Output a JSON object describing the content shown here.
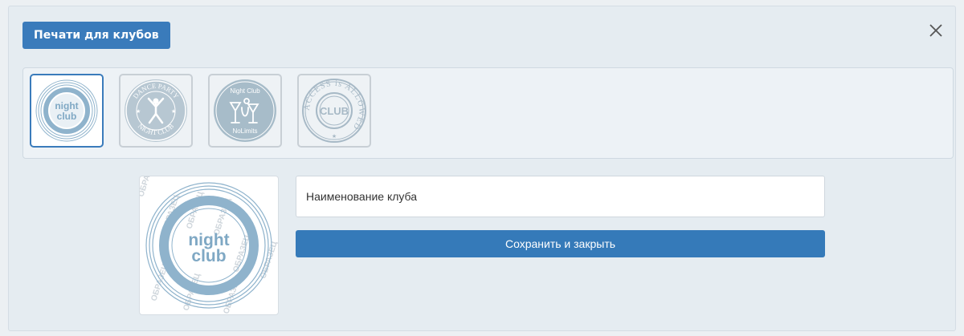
{
  "dialog": {
    "title": "Печати для клубов"
  },
  "stamps": [
    {
      "name": "night-club",
      "lines": [
        "night",
        "club"
      ],
      "selected": true
    },
    {
      "name": "dance-party",
      "top_text": "DANCE PARTY",
      "bottom_text": "NIGHT CLUB",
      "selected": false
    },
    {
      "name": "night-club-nolimits",
      "top_text": "Night Club",
      "bottom_text": "NoLimits",
      "selected": false
    },
    {
      "name": "access-is-allowed",
      "ring_text": "ACCESS is ALLOWED",
      "center_text": "CLUB",
      "selected": false
    }
  ],
  "preview": {
    "lines": [
      "night",
      "club"
    ],
    "watermark": "ОБРАЗЕЦ"
  },
  "form": {
    "name_placeholder": "Наименование клуба",
    "save_label": "Сохранить и закрыть"
  },
  "colors": {
    "accent": "#357ab9",
    "stamp_blue": "#8fb3cc",
    "stamp_gray": "#a7b9c6"
  }
}
